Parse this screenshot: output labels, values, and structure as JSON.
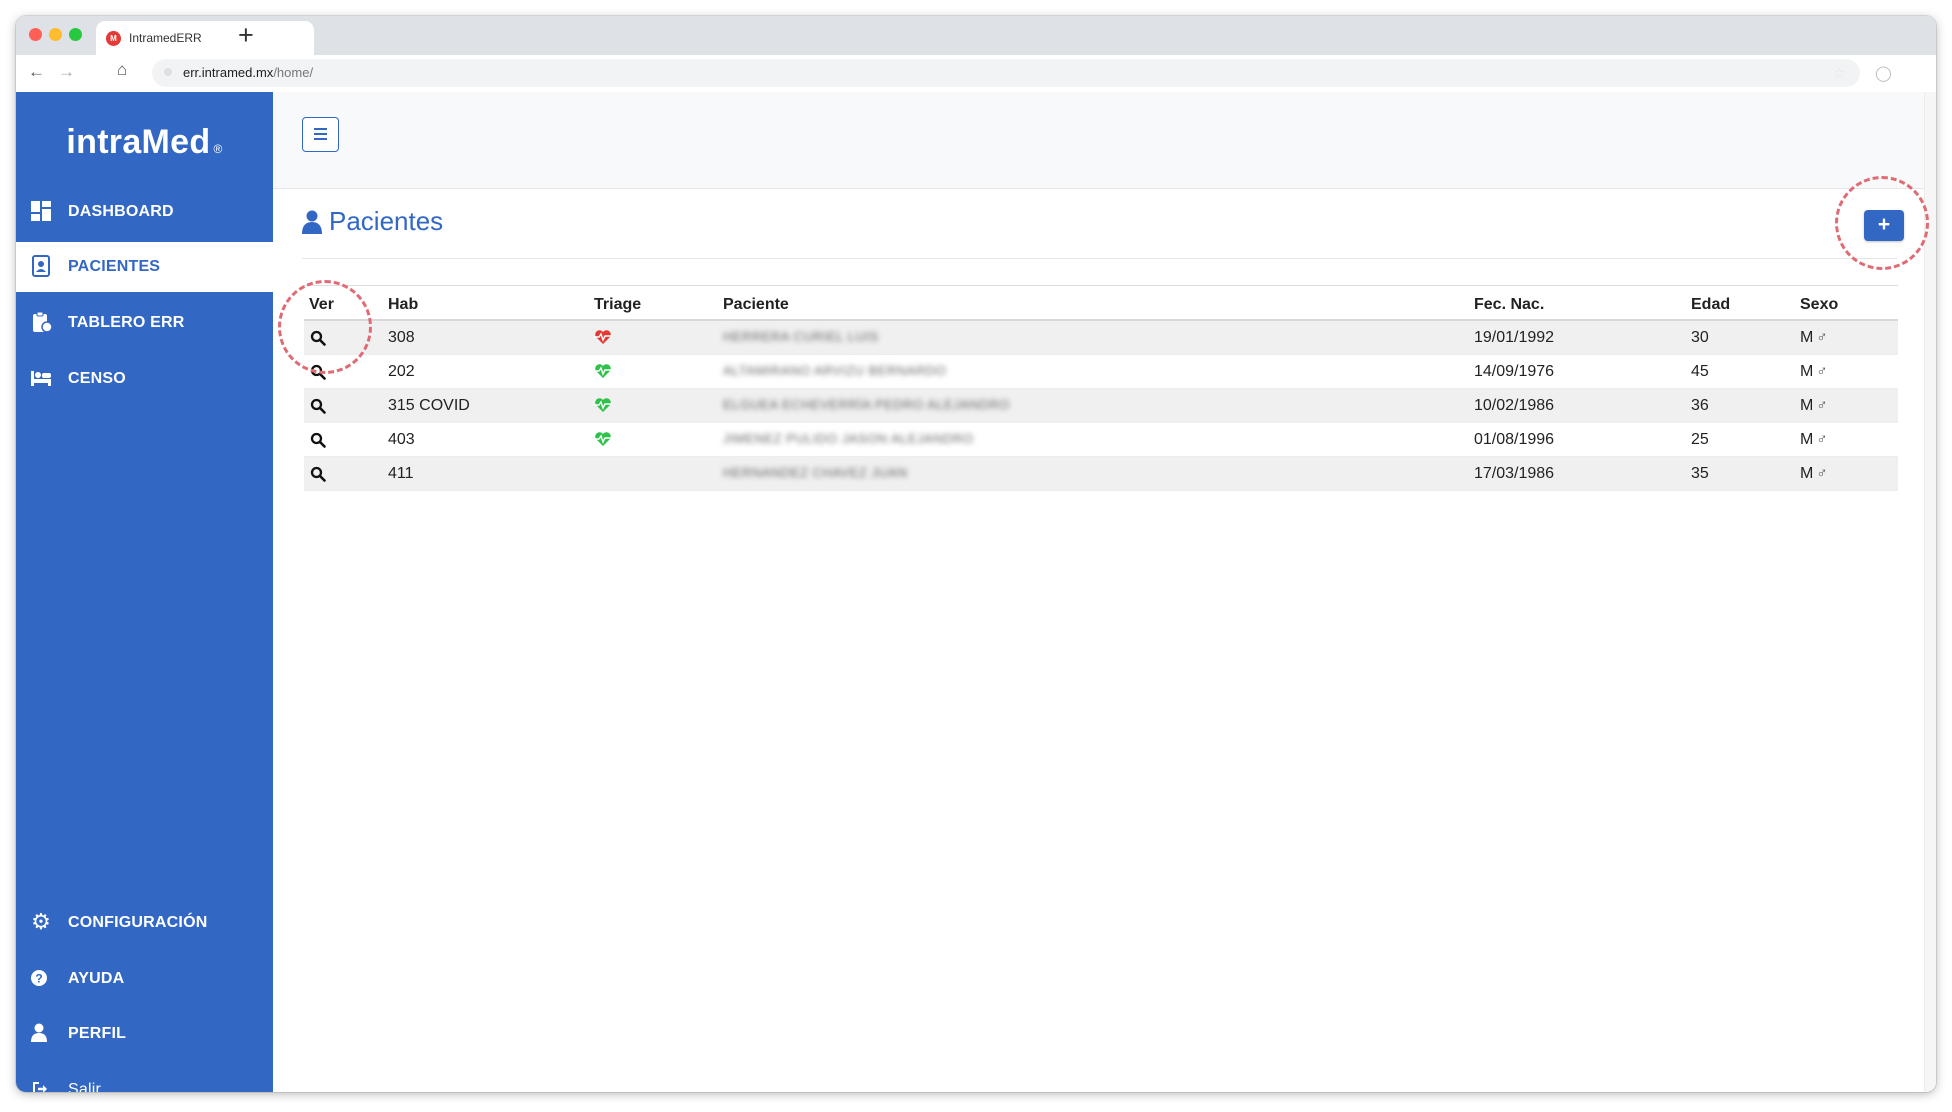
{
  "browser": {
    "tab_title": "IntramedERR",
    "favicon_text": "M",
    "new_tab": "+",
    "url_host": "err.intramed.mx",
    "url_path": "/home/"
  },
  "sidebar": {
    "logo": "intraMed",
    "logo_mark": "®",
    "items": [
      {
        "label": "DASHBOARD",
        "icon": "dashboard-icon"
      },
      {
        "label": "PACIENTES",
        "icon": "patient-card-icon"
      },
      {
        "label": "TABLERO ERR",
        "icon": "clipboard-icon"
      },
      {
        "label": "CENSO",
        "icon": "bed-icon"
      }
    ],
    "bottom_items": [
      {
        "label": "CONFIGURACIÓN",
        "icon": "gear-icon"
      },
      {
        "label": "AYUDA",
        "icon": "question-icon"
      },
      {
        "label": "PERFIL",
        "icon": "user-icon"
      },
      {
        "label": "Salir",
        "icon": "sign-out-icon"
      }
    ]
  },
  "page": {
    "title": "Pacientes",
    "add_label": "+"
  },
  "table": {
    "columns": [
      "Ver",
      "Hab",
      "Triage",
      "Paciente",
      "Fec. Nac.",
      "Edad",
      "Sexo"
    ],
    "rows": [
      {
        "hab": "308",
        "triage": "red",
        "paciente": "HERRERA CURIEL LUIS",
        "fec_nac": "19/01/1992",
        "edad": "30",
        "sexo": "M",
        "sexo_symbol": "♂"
      },
      {
        "hab": "202",
        "triage": "green",
        "paciente": "ALTAMIRANO ARVIZU BERNARDO",
        "fec_nac": "14/09/1976",
        "edad": "45",
        "sexo": "M",
        "sexo_symbol": "♂"
      },
      {
        "hab": "315 COVID",
        "triage": "green",
        "paciente": "ELGUEA ECHEVERRÍA PEDRO ALEJANDRO",
        "fec_nac": "10/02/1986",
        "edad": "36",
        "sexo": "M",
        "sexo_symbol": "♂"
      },
      {
        "hab": "403",
        "triage": "green",
        "paciente": "JIMENEZ PULIDO JASON ALEJANDRO",
        "fec_nac": "01/08/1996",
        "edad": "25",
        "sexo": "M",
        "sexo_symbol": "♂"
      },
      {
        "hab": "411",
        "triage": "none",
        "paciente": "HERNANDEZ CHAVEZ JUAN",
        "fec_nac": "17/03/1986",
        "edad": "35",
        "sexo": "M",
        "sexo_symbol": "♂"
      }
    ]
  },
  "colors": {
    "brand": "#3267c4",
    "triage_red": "#e53935",
    "triage_green": "#2fc24a",
    "highlight": "#df6b74"
  }
}
